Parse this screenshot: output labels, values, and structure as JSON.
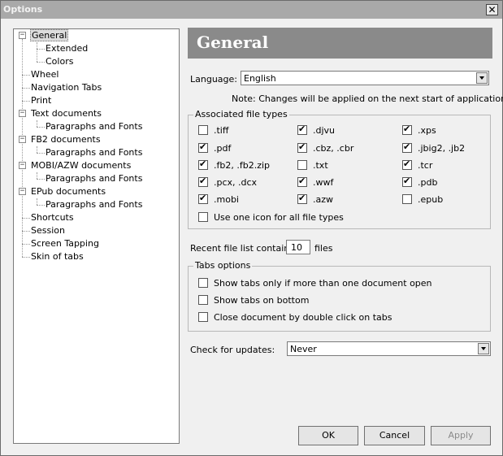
{
  "window": {
    "title": "Options"
  },
  "tree": {
    "items": [
      {
        "label": "General"
      },
      {
        "label": "Extended"
      },
      {
        "label": "Colors"
      },
      {
        "label": "Wheel"
      },
      {
        "label": "Navigation Tabs"
      },
      {
        "label": "Print"
      },
      {
        "label": "Text documents"
      },
      {
        "label": "Paragraphs and Fonts"
      },
      {
        "label": "FB2 documents"
      },
      {
        "label": "Paragraphs and Fonts"
      },
      {
        "label": "MOBI/AZW documents"
      },
      {
        "label": "Paragraphs and Fonts"
      },
      {
        "label": "EPub documents"
      },
      {
        "label": "Paragraphs and Fonts"
      },
      {
        "label": "Shortcuts"
      },
      {
        "label": "Session"
      },
      {
        "label": "Screen Tapping"
      },
      {
        "label": "Skin of tabs"
      }
    ]
  },
  "header": {
    "title": "General"
  },
  "language": {
    "label": "Language:",
    "value": "English",
    "note": "Note: Changes will be applied on the next start of application"
  },
  "assoc": {
    "title": "Associated file types",
    "items": [
      {
        "label": ".tiff",
        "checked": false
      },
      {
        "label": ".djvu",
        "checked": true
      },
      {
        "label": ".xps",
        "checked": true
      },
      {
        "label": ".pdf",
        "checked": true
      },
      {
        "label": ".cbz, .cbr",
        "checked": true
      },
      {
        "label": ".jbig2, .jb2",
        "checked": true
      },
      {
        "label": ".fb2, .fb2.zip",
        "checked": true
      },
      {
        "label": ".txt",
        "checked": false
      },
      {
        "label": ".tcr",
        "checked": true
      },
      {
        "label": ".pcx, .dcx",
        "checked": true
      },
      {
        "label": ".wwf",
        "checked": true
      },
      {
        "label": ".pdb",
        "checked": true
      },
      {
        "label": ".mobi",
        "checked": true
      },
      {
        "label": ".azw",
        "checked": true
      },
      {
        "label": ".epub",
        "checked": false
      }
    ],
    "one_icon": {
      "label": "Use one icon for all file types",
      "checked": false
    }
  },
  "recent": {
    "label": "Recent file list contains:",
    "value": "10",
    "suffix": "files"
  },
  "tabs": {
    "title": "Tabs options",
    "items": [
      {
        "label": "Show tabs only if more than one document open",
        "checked": false
      },
      {
        "label": "Show tabs on bottom",
        "checked": false
      },
      {
        "label": "Close document by double click on tabs",
        "checked": false
      }
    ]
  },
  "updates": {
    "label": "Check for updates:",
    "value": "Never"
  },
  "buttons": {
    "ok": "OK",
    "cancel": "Cancel",
    "apply": "Apply"
  }
}
